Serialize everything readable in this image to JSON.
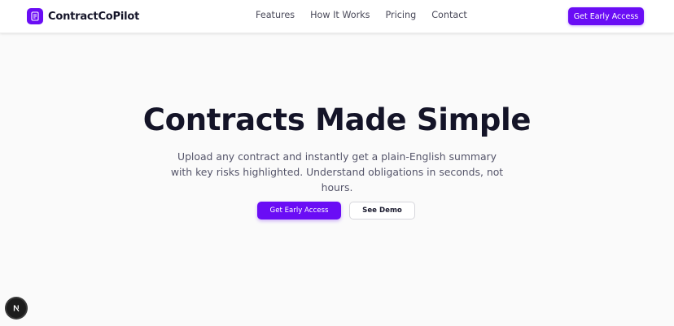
{
  "brand": {
    "name": "ContractCoPilot",
    "logo_icon": "document-icon",
    "accent_color": "#6a0df5"
  },
  "nav": {
    "links": [
      "Features",
      "How It Works",
      "Pricing",
      "Contact"
    ],
    "cta_label": "Get Early Access"
  },
  "hero": {
    "title": "Contracts Made Simple",
    "subtitle": "Upload any contract and instantly get a plain-English summary with key risks highlighted. Understand obligations in seconds, not hours.",
    "primary_cta": "Get Early Access",
    "secondary_cta": "See Demo"
  },
  "dev_badge": {
    "icon": "nextjs-logo-icon"
  }
}
